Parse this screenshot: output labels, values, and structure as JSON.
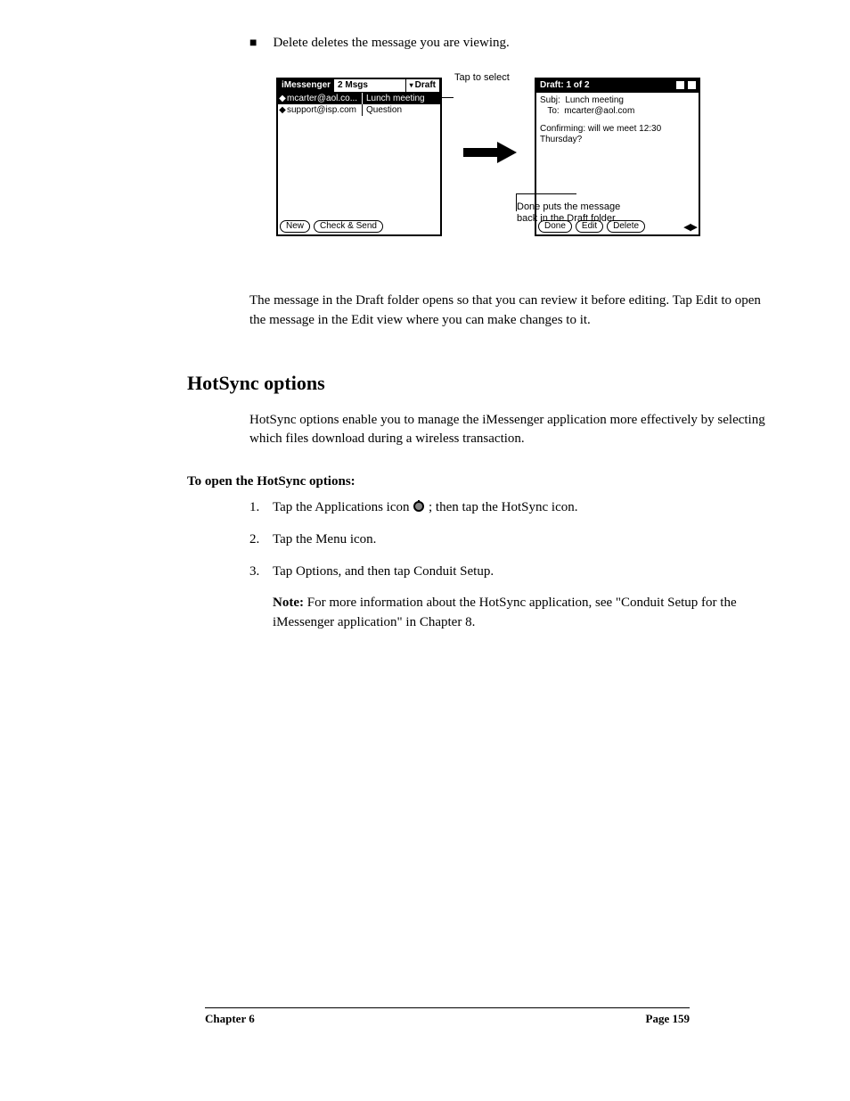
{
  "bullet_intro": "Delete deletes the message you are viewing.",
  "screens_area": {
    "caption_tap_select": "Tap to select",
    "caption_done_line1": "Done puts the message",
    "caption_done_line2": "back in the Draft folder",
    "left": {
      "title_app": "iMessenger",
      "title_count": "2 Msgs",
      "title_folder": "Draft",
      "rows": [
        {
          "sender": "mcarter@aol.co...",
          "subject": "Lunch meeting",
          "selected": true
        },
        {
          "sender": "support@isp.com",
          "subject": "Question",
          "selected": false
        }
      ],
      "btn_new": "New",
      "btn_check": "Check & Send"
    },
    "right": {
      "title": "Draft: 1 of 2",
      "subj_label": "Subj:",
      "subj_value": "Lunch meeting",
      "to_label": "To:",
      "to_value": "mcarter@aol.com",
      "body_line1": "Confirming: will we meet 12:30",
      "body_line2": "Thursday?",
      "btn_done": "Done",
      "btn_edit": "Edit",
      "btn_delete": "Delete"
    }
  },
  "para_after": "The message in the Draft folder opens so that you can review it before editing. Tap Edit to open the message in the Edit view where you can make changes to it.",
  "section_heading": "HotSync options",
  "section_intro": "HotSync options enable you to manage the iMessenger application more effectively by selecting which files download during a wireless transaction.",
  "subheading": "To open the HotSync options:",
  "step1_text": "Tap the Applications icon ",
  "step1_tail": "; then tap the HotSync icon.",
  "step2_text": "Tap the Menu icon.",
  "step3_text": "Tap Options, and then tap Conduit Setup.",
  "note_label": "Note:",
  "note_text": "For more information about the HotSync application, see \"Conduit Setup for the iMessenger application\" in Chapter 8.",
  "footer_left": "Chapter 6",
  "footer_right": "Page 159"
}
